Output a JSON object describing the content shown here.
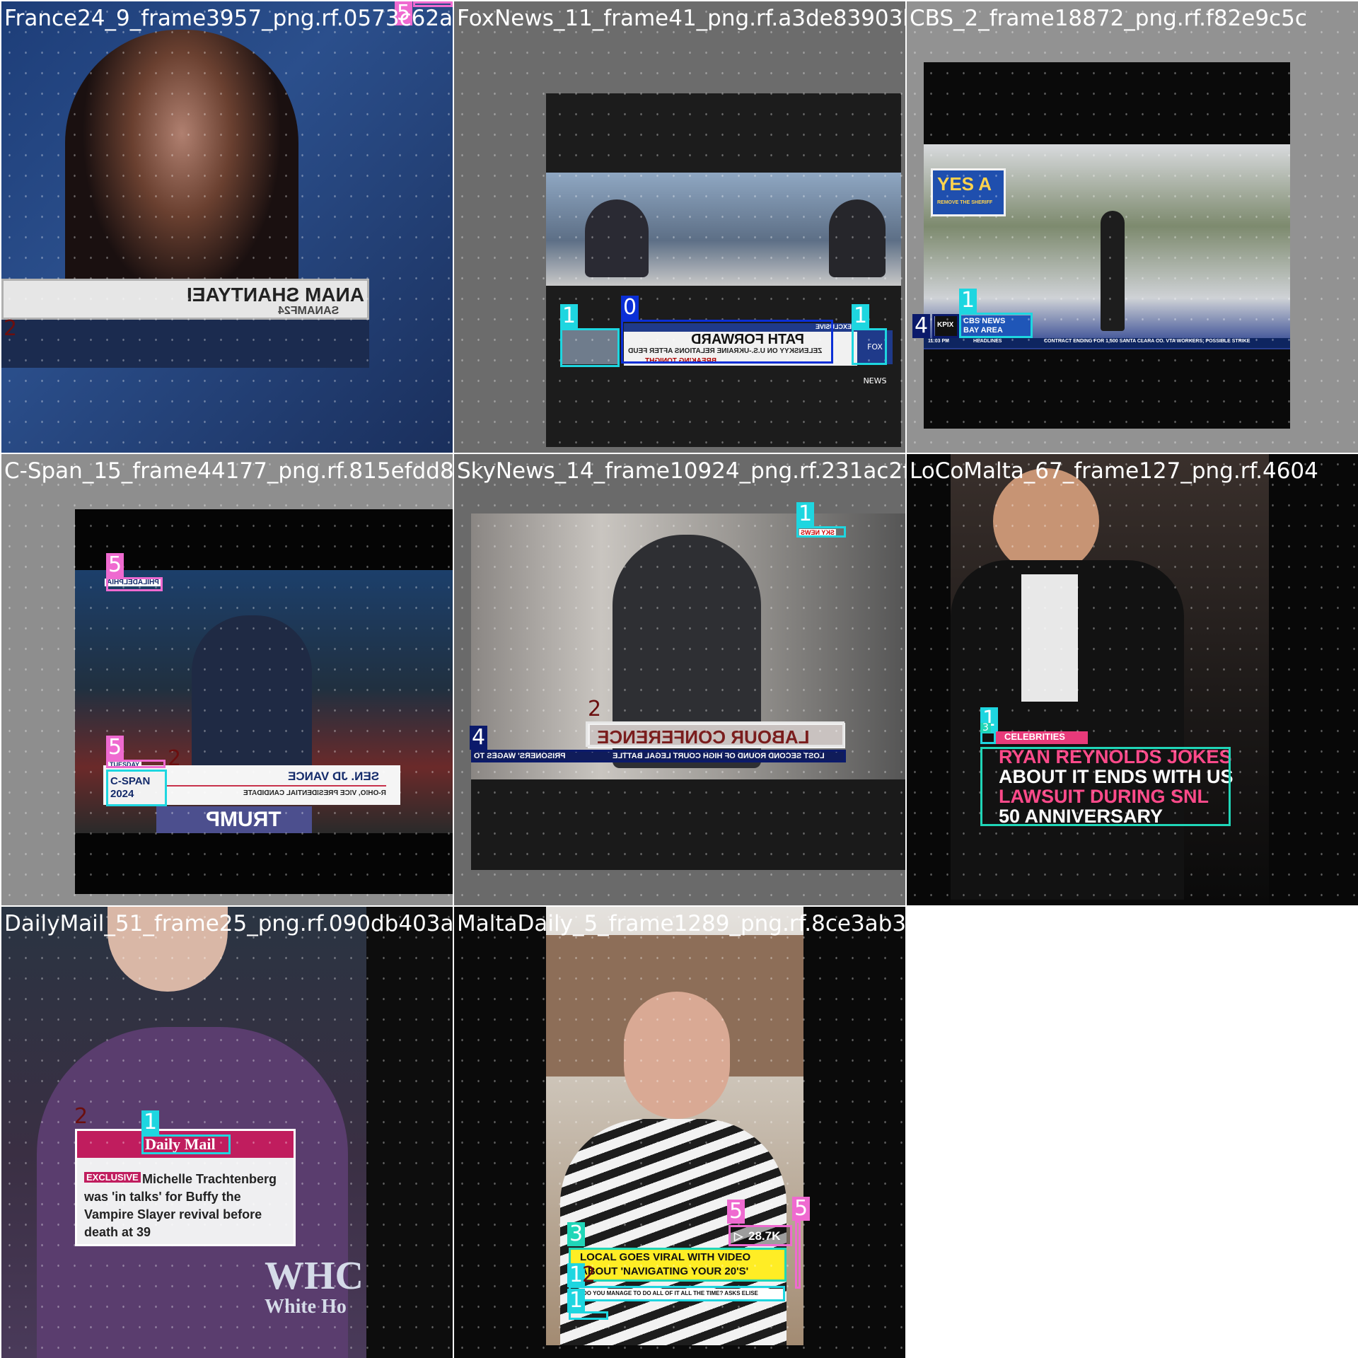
{
  "colors": {
    "class0": "#0b2fd6",
    "class1": "#1ed6e0",
    "class2": "#6b0f0f",
    "class3": "#20d6b8",
    "class4": "#0b1a6b",
    "class5": "#ef6ad0",
    "tile_bg": "#808080"
  },
  "tiles": [
    {
      "filename": "France24_9_frame3957_png.rf.0573c62a1b9",
      "lower_third_name": "ANAM SHANTYAEI",
      "lower_third_sub": "SANAMF24",
      "labels": [
        "5",
        "2"
      ]
    },
    {
      "filename": "FoxNews_11_frame41_png.rf.a3de83903b201a",
      "headline_top": "EXCLUSIVE",
      "headline_main": "PATH FORWARD",
      "headline_sub": "ZELENSKYY ON U.S.-UKRAINE RELATIONS AFTER FEUD",
      "headline_tag": "BREAKING TONIGHT",
      "logo": "FOX NEWS",
      "labels": [
        "1",
        "0",
        "1"
      ]
    },
    {
      "filename": "CBS_2_frame18872_png.rf.f82e9c5c",
      "sign": "YES A",
      "sign_sub": "REMOVE THE SHERIFF",
      "station": "KPIX",
      "bug": "CBS NEWS BAY AREA",
      "ticker_time": "11:03 PM",
      "ticker_label": "HEADLINES",
      "ticker": "CONTRACT ENDING FOR 1,500 SANTA CLARA CO. VTA WORKERS; POSSIBLE STRIKE",
      "labels": [
        "1",
        "4"
      ]
    },
    {
      "filename": "C-Span_15_frame44177_png.rf.815efdd8e0",
      "location": "PHILADELPHIA",
      "day": "TUESDAY",
      "logo": "C-SPAN 2024",
      "name": "SEN. JD VANCE",
      "title": "R-OHIO, VICE PRESIDENTIAL CANDIDATE",
      "sign": "TRUMP",
      "labels": [
        "5",
        "5",
        "2"
      ]
    },
    {
      "filename": "SkyNews_14_frame10924_png.rf.231ac2ff1d",
      "bug": "SKY NEWS",
      "headline": "LABOUR CONFERENCE",
      "ticker_left": "PRISONERS' WAGES TO",
      "ticker_right": "LOST SECOND ROUND OF HIGH COURT LEGAL BATTLE",
      "labels": [
        "1",
        "2",
        "4"
      ]
    },
    {
      "filename": "LoCoMalta_67_frame127_png.rf.4604",
      "tag": "CELEBRITIES",
      "caption_lines": [
        "RYAN REYNOLDS JOKES",
        "ABOUT IT ENDS WITH US",
        "LAWSUIT DURING SNL",
        "50 ANNIVERSARY"
      ],
      "labels": [
        "1",
        "3"
      ]
    },
    {
      "filename": "DailyMail_51_frame25_png.rf.090db403a18f",
      "logo": "Daily Mail",
      "exclusive": "EXCLUSIVE",
      "story": "Michelle Trachtenberg was 'in talks' for Buffy the Vampire Slayer revival before death at 39",
      "backdrop": "WHC",
      "backdrop_sub": "White Ho",
      "labels": [
        "2",
        "1"
      ]
    },
    {
      "filename": "MaltaDaily_5_frame1289_png.rf.8ce3ab334f",
      "views": "28.7K",
      "caption": "LOCAL GOES VIRAL WITH VIDEO ABOUT 'NAVIGATING YOUR 20'S'",
      "sub": "DO YOU MANAGE TO DO ALL OF IT ALL THE TIME? ASKS ELISE",
      "labels": [
        "5",
        "5",
        "3",
        "1",
        "2",
        "1"
      ]
    }
  ]
}
